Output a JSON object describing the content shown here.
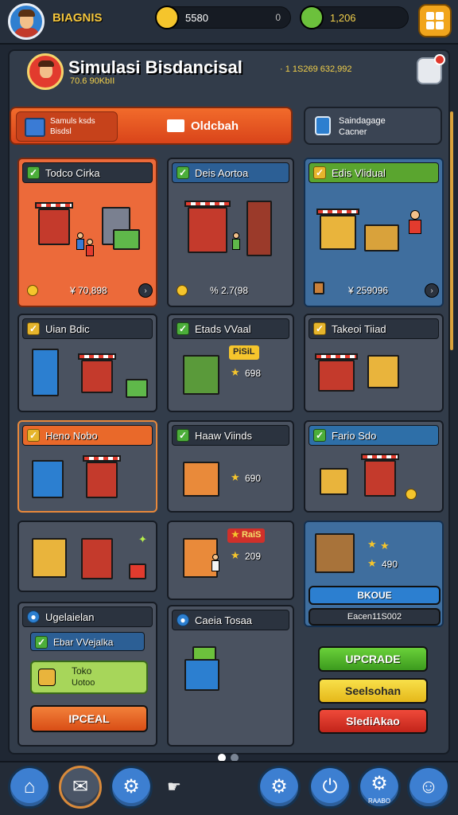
{
  "player": {
    "name": "BIAGNIS"
  },
  "resources": {
    "coins": "5580",
    "coins_extra": "0",
    "cash": "1,206"
  },
  "colors": {
    "accent": "#f1a51c",
    "orange": "#ec6a3a",
    "blue": "#3f6e9e",
    "green": "#4cae3a",
    "panel": "#323c4a"
  },
  "header": {
    "title": "Simulasi Bisdancisal",
    "subtitle": "· 1 1S269 632,992",
    "subtitle2": "70.6 90KbII"
  },
  "tabs": {
    "active_left_line1": "Samuls ksds",
    "active_left_line2": "Bisdsl",
    "active_label": "Oldcbah",
    "other_line1": "Saindagage",
    "other_line2": "Cacner"
  },
  "shops": [
    {
      "title": "Todco Cirka",
      "footer": "¥ 70,898"
    },
    {
      "title": "Deis Aortoa",
      "footer": "% 2.7(98"
    },
    {
      "title": "Edis Vlidual",
      "footer": "¥ 259096"
    },
    {
      "title": "Uian Bdic"
    },
    {
      "title": "Etads VVaal",
      "badge": "PiSiL",
      "rating": "698"
    },
    {
      "title": "Takeoi Tiiad"
    },
    {
      "title": "Heno Nobo"
    },
    {
      "title": "Haaw Viinds",
      "rating": "690"
    },
    {
      "title": "Fario Sdo"
    },
    {},
    {
      "badge": "RaiS",
      "rating": "209"
    },
    {
      "rating": "490",
      "button": "BKOUE",
      "bottom": "Eacen11S002"
    }
  ],
  "upgrade_panel": {
    "title": "Ugelaielan",
    "row": "Ebar VVejalka",
    "box_line1": "Toko",
    "box_line2": "Uotoo",
    "button": "IPCEAL"
  },
  "panel_b": {
    "title": "Caeia Tosaa"
  },
  "actions": {
    "upgrade": "UPCRADE",
    "yellow": "Seelsohan",
    "red": "SlediAkao"
  },
  "nav": {
    "caption": "RAABO"
  }
}
